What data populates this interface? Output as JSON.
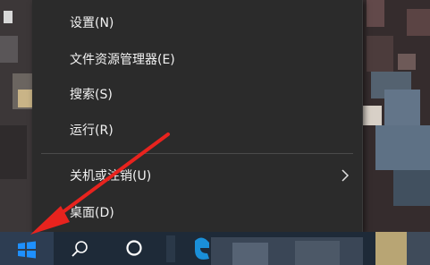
{
  "context_menu": {
    "items": [
      {
        "label": "设置(N)"
      },
      {
        "label": "文件资源管理器(E)"
      },
      {
        "label": "搜索(S)"
      },
      {
        "label": "运行(R)"
      },
      {
        "label": "关机或注销(U)",
        "has_submenu": true
      },
      {
        "label": "桌面(D)"
      }
    ]
  },
  "taskbar": {
    "start_icon": "windows-logo-icon",
    "search_icon": "search-icon",
    "cortana_icon": "cortana-circle-icon",
    "edge_icon": "edge-icon"
  },
  "colors": {
    "menu_bg": "#2b2b2b",
    "menu_text": "#f2f2f2",
    "taskbar_bg": "#1e2a38",
    "windows_blue": "#1e90ff",
    "annotation_red": "#e8231e"
  },
  "annotation": {
    "type": "arrow",
    "points_to": "start-button",
    "color": "red"
  }
}
